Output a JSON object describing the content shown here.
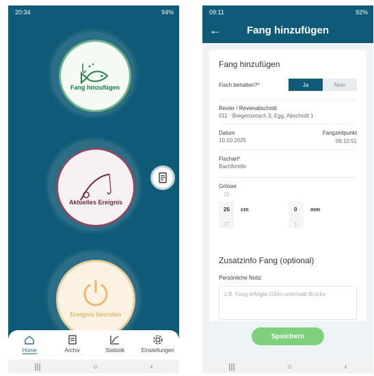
{
  "left": {
    "status": {
      "time": "20:34",
      "battery": "94%"
    },
    "buttons": {
      "add_catch": "Fang hinzufügen",
      "current_event": "Aktuelles Ereignis",
      "end_event": "Ereignis beenden"
    },
    "nav": [
      {
        "label": "Home",
        "icon": "home-icon"
      },
      {
        "label": "Archiv",
        "icon": "clipboard-icon"
      },
      {
        "label": "Statistik",
        "icon": "chart-icon"
      },
      {
        "label": "Einstellungen",
        "icon": "gear-icon"
      }
    ],
    "system_nav": {
      "recent": "|||",
      "home": "○",
      "back": "‹"
    }
  },
  "right": {
    "status": {
      "time": "09:11",
      "battery": "92%"
    },
    "header": {
      "back": "←",
      "title": "Fang hinzufügen"
    },
    "card1": {
      "title": "Fang hinzufügen",
      "keep_label": "Fisch behalten?*",
      "keep_yes": "Ja",
      "keep_no": "Nein",
      "revier_label": "Revier / Revierabschnitt",
      "revier_value": "011 · Bregenzerach 3, Egg, Abschnitt 1",
      "date_label": "Datum",
      "date_value": "10.10.2025",
      "time_label": "Fangzeitpunkt",
      "time_value": "09:10:51",
      "species_label": "Fischart*",
      "species_value": "Bachforelle",
      "size_label": "Grösse",
      "cm": {
        "prev": "25",
        "selected": "26",
        "next": "27",
        "unit": "cm"
      },
      "mm": {
        "prev": "",
        "selected": "0",
        "next": "1",
        "unit": "mm"
      }
    },
    "card2": {
      "title": "Zusatzinfo Fang (optional)",
      "note_label": "Persönliche Notiz",
      "note_placeholder": "z.B. Fang erfolgte 100m unterhalb Brücke"
    },
    "save": "Speichern",
    "system_nav": {
      "recent": "|||",
      "home": "○",
      "back": "‹"
    }
  }
}
